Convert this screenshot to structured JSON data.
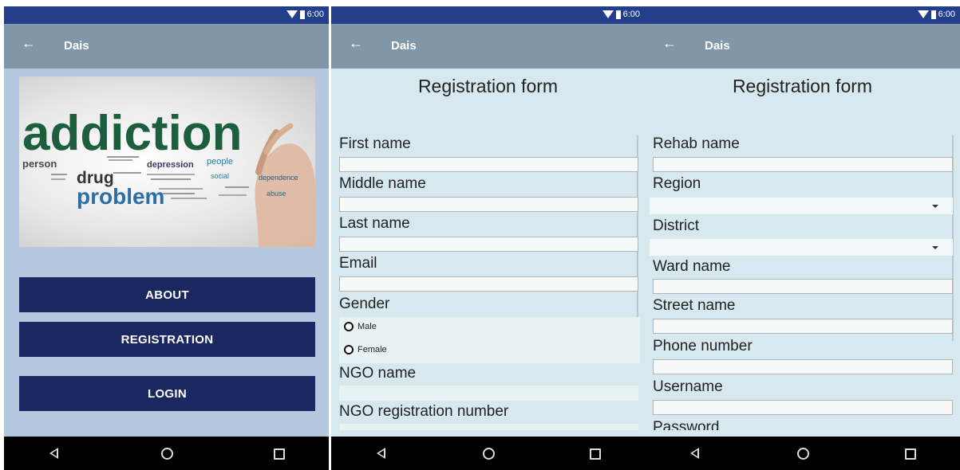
{
  "status": {
    "time": "6:00"
  },
  "app": {
    "title": "Dais"
  },
  "home": {
    "hero_words": {
      "big": "addiction",
      "mid": "problem",
      "drug": "drug",
      "person": "person",
      "depression": "depression",
      "people": "people",
      "social": "social",
      "dependence": "dependence",
      "abuse": "abuse"
    },
    "buttons": [
      "ABOUT",
      "REGISTRATION",
      "LOGIN"
    ]
  },
  "form1": {
    "title": "Registration form",
    "first_name": "First name",
    "middle_name": "Middle name",
    "last_name": "Last name",
    "email": "Email",
    "gender": "Gender",
    "gender_options": [
      "Male",
      "Female"
    ],
    "ngo_name": "NGO name",
    "ngo_reg": "NGO registration number"
  },
  "form2": {
    "title": "Registration form",
    "rehab_name": "Rehab name",
    "region": "Region",
    "district": "District",
    "ward_name": "Ward name",
    "street_name": "Street name",
    "phone": "Phone number",
    "username": "Username",
    "password": "Password"
  },
  "icons": {
    "back": "back-arrow-icon",
    "wifi": "wifi-icon",
    "battery": "battery-icon",
    "nav_back": "nav-back-icon",
    "nav_home": "nav-home-icon",
    "nav_recents": "nav-recents-icon"
  }
}
